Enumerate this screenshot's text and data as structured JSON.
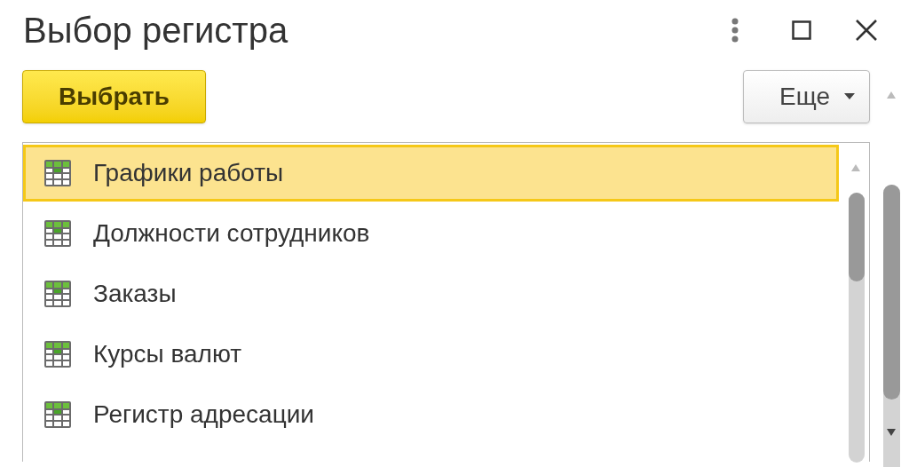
{
  "window": {
    "title": "Выбор регистра"
  },
  "toolbar": {
    "select_button": "Выбрать",
    "more_button": "Еще"
  },
  "list": {
    "items": [
      {
        "label": "Графики работы",
        "selected": true
      },
      {
        "label": "Должности сотрудников",
        "selected": false
      },
      {
        "label": "Заказы",
        "selected": false
      },
      {
        "label": "Курсы валют",
        "selected": false
      },
      {
        "label": "Регистр адресации",
        "selected": false
      }
    ]
  }
}
